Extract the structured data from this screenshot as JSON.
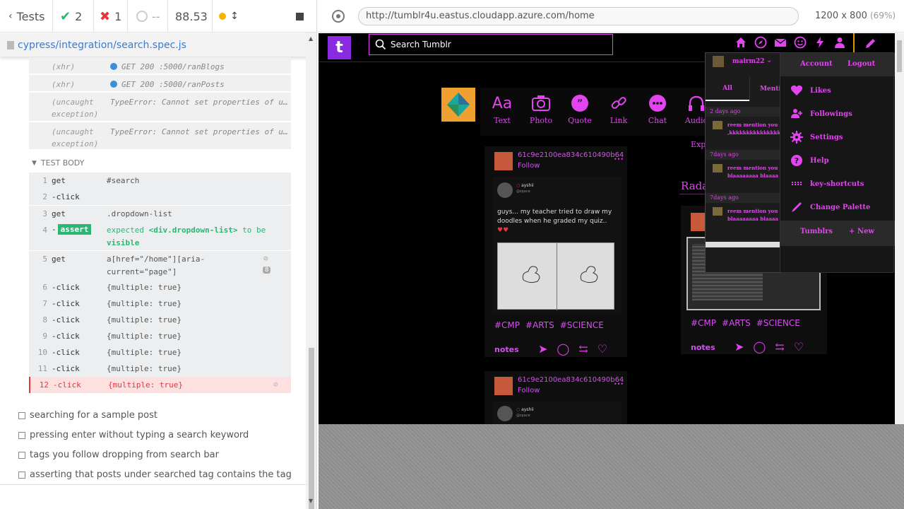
{
  "reporter": {
    "tests_label": "Tests",
    "passed": "2",
    "failed": "1",
    "pending": "--",
    "duration": "88.53",
    "spec_path": "cypress/integration/search.spec.js",
    "logs": [
      {
        "type": "(xhr)",
        "msg": "GET 200 :5000/ranBlogs"
      },
      {
        "type": "(xhr)",
        "msg": "GET 200 :5000/ranPosts"
      },
      {
        "type": "(uncaught exception)",
        "msg": "TypeError: Cannot set properties of u…"
      },
      {
        "type": "(uncaught exception)",
        "msg": "TypeError: Cannot set properties of u…"
      }
    ],
    "test_body_label": "TEST BODY",
    "commands": [
      {
        "n": "1",
        "cmd": "get",
        "arg": "#search"
      },
      {
        "n": "2",
        "cmd": "-click",
        "arg": ""
      },
      {
        "n": "3",
        "cmd": "get",
        "arg": ".dropdown-list"
      },
      {
        "n": "4",
        "cmd": "-assert",
        "arg": "expected <div.dropdown-list> to be visible"
      },
      {
        "n": "5",
        "cmd": "get",
        "arg": "a[href=\"/home\"][aria-current=\"page\"]",
        "badge": "8"
      },
      {
        "n": "6",
        "cmd": "-click",
        "arg": "{multiple: true}"
      },
      {
        "n": "7",
        "cmd": "-click",
        "arg": "{multiple: true}"
      },
      {
        "n": "8",
        "cmd": "-click",
        "arg": "{multiple: true}"
      },
      {
        "n": "9",
        "cmd": "-click",
        "arg": "{multiple: true}"
      },
      {
        "n": "10",
        "cmd": "-click",
        "arg": "{multiple: true}"
      },
      {
        "n": "11",
        "cmd": "-click",
        "arg": "{multiple: true}"
      },
      {
        "n": "12",
        "cmd": "-click",
        "arg": "{multiple: true}"
      }
    ],
    "assert_expected": "expected",
    "assert_subject": "<div.dropdown-list>",
    "assert_to_be": "to be",
    "assert_visible": "visible",
    "get5_line1": "a[href=\"/home\"][aria-",
    "get5_line2": "current=\"page\"]",
    "pending_tests": [
      "searching for a sample post",
      "pressing enter without typing a search keyword",
      "tags you follow dropping from search bar",
      "asserting that posts under searched tag contains the tag"
    ]
  },
  "browser": {
    "url": "http://tumblr4u.eastus.cloudapp.azure.com/home",
    "viewport": "1200 x 800",
    "zoom": "(69%)"
  },
  "app": {
    "logo_letter": "t",
    "search_placeholder": "Search Tumblr",
    "post_types": [
      "Text",
      "Photo",
      "Quote",
      "Link",
      "Chat",
      "Audio"
    ],
    "post_types_icon_text": "Aa",
    "explore_label": "Exp",
    "radar_label": "Rada",
    "post": {
      "author": "61c9e2100ea834c610490b64",
      "follow": "Follow",
      "inner_user": "ayshii",
      "inner_handle": "@space",
      "text": "guys... my teacher tried to draw my doodles when he graded my quiz..",
      "tags": [
        "#CMP",
        "#ARTS",
        "#SCIENCE"
      ],
      "notes": "notes"
    },
    "post2": {
      "author": "61c9e2100ea834c610490b64",
      "follow": "Follow",
      "inner_user": "ayshii",
      "inner_handle": "@space"
    },
    "radar_post": {
      "tags": [
        "#CMP",
        "#ARTS",
        "#SCIENCE"
      ],
      "notes": "notes"
    },
    "activity": {
      "username": "mairm22",
      "tab_all": "All",
      "tab_mentions": "Menti",
      "items": [
        {
          "time": "2 days ago",
          "text1": "reem mention you",
          "text2": ",kkkkkkkkkkkkkkk"
        },
        {
          "time": "7days ago",
          "text1": "reem mention you",
          "text2": "blaaaaaaaa blaaaa"
        },
        {
          "time": "7days ago",
          "text1": "reem mention you",
          "text2": "blaaaaaaaa blaaaa"
        }
      ]
    },
    "account_menu": {
      "account": "Account",
      "logout": "Logout",
      "items": [
        "Likes",
        "Followings",
        "Settings",
        "Help",
        "key-shortcuts",
        "Change Palette"
      ],
      "tumblrs": "Tumblrs",
      "new": "+ New"
    }
  },
  "colors": {
    "accent": "#e244f0",
    "logo_bg": "#8a2be2",
    "pass": "#2bb673",
    "fail": "#e0393e"
  }
}
